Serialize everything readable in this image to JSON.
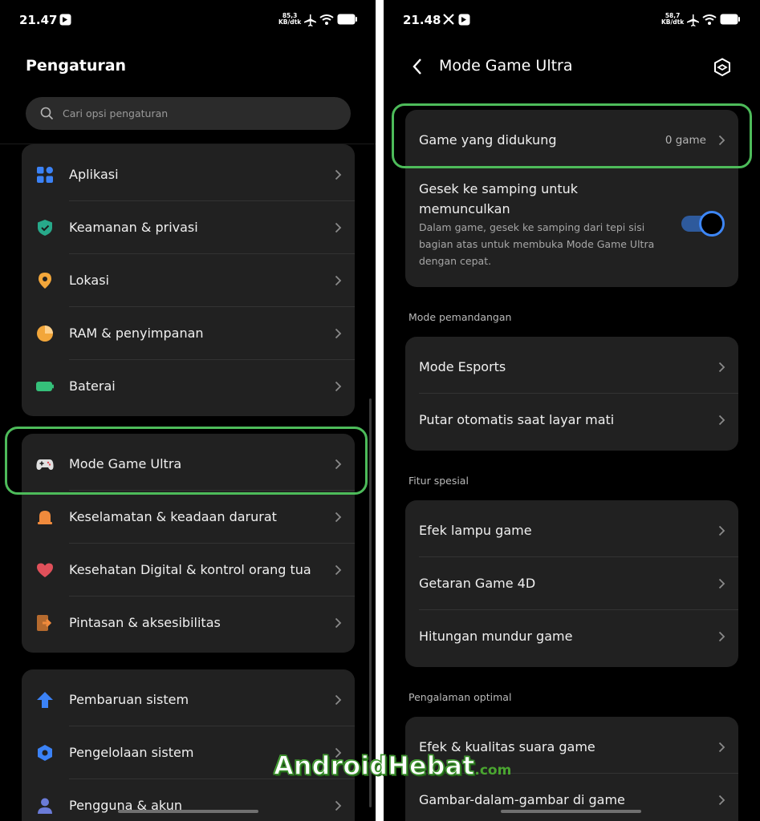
{
  "left": {
    "status": {
      "time": "21.47",
      "netspeed_value": "85,3",
      "netspeed_unit": "KB/dtk"
    },
    "title": "Pengaturan",
    "search_placeholder": "Cari opsi pengaturan",
    "items": [
      {
        "label": "Aplikasi",
        "icon": "apps-icon",
        "color": "#3b82f6"
      },
      {
        "label": "Keamanan & privasi",
        "icon": "shield-icon",
        "color": "#27a98a"
      },
      {
        "label": "Lokasi",
        "icon": "location-pin-icon",
        "color": "#f2a63a"
      },
      {
        "label": "RAM & penyimpanan",
        "icon": "storage-pie-icon",
        "color": "#f2a63a"
      },
      {
        "label": "Baterai",
        "icon": "battery-icon",
        "color": "#35c07a"
      },
      {
        "label": "Mode Game Ultra",
        "icon": "gamepad-icon",
        "color": "#e0e0e0"
      },
      {
        "label": "Keselamatan & keadaan darurat",
        "icon": "alarm-bell-icon",
        "color": "#f08a3c"
      },
      {
        "label": "Kesehatan Digital & kontrol orang tua",
        "icon": "heart-icon",
        "color": "#e0505a"
      },
      {
        "label": "Pintasan & aksesibilitas",
        "icon": "shortcut-icon",
        "color": "#f08a3c"
      },
      {
        "label": "Pembaruan sistem",
        "icon": "update-arrow-icon",
        "color": "#3b82f6"
      },
      {
        "label": "Pengelolaan sistem",
        "icon": "hexagon-icon",
        "color": "#3b82f6"
      },
      {
        "label": "Pengguna & akun",
        "icon": "user-icon",
        "color": "#6a7bd8"
      }
    ]
  },
  "right": {
    "status": {
      "time": "21.48",
      "netspeed_value": "58,7",
      "netspeed_unit": "KB/dtk"
    },
    "title": "Mode Game Ultra",
    "supported_games": {
      "label": "Game yang didukung",
      "value": "0 game"
    },
    "swipe": {
      "title_line1": "Gesek ke samping untuk",
      "title_line2": "memunculkan",
      "desc_line1": "Dalam game, gesek ke samping dari tepi sisi",
      "desc_line2": "bagian atas untuk membuka Mode Game Ultra",
      "desc_line3": "dengan cepat.",
      "enabled": true
    },
    "sections": [
      {
        "title": "Mode pemandangan",
        "items": [
          "Mode Esports",
          "Putar otomatis saat layar mati"
        ]
      },
      {
        "title": "Fitur spesial",
        "items": [
          "Efek lampu game",
          "Getaran Game 4D",
          "Hitungan mundur game"
        ]
      },
      {
        "title": "Pengalaman optimal",
        "items": [
          "Efek & kualitas suara game",
          "Gambar-dalam-gambar di game"
        ]
      }
    ]
  },
  "watermark": {
    "main": "AndroidHebat",
    "suffix": ".com"
  },
  "colors": {
    "highlight": "#4dbb5a",
    "toggle_on": "#3d86f6",
    "card": "#212121"
  }
}
